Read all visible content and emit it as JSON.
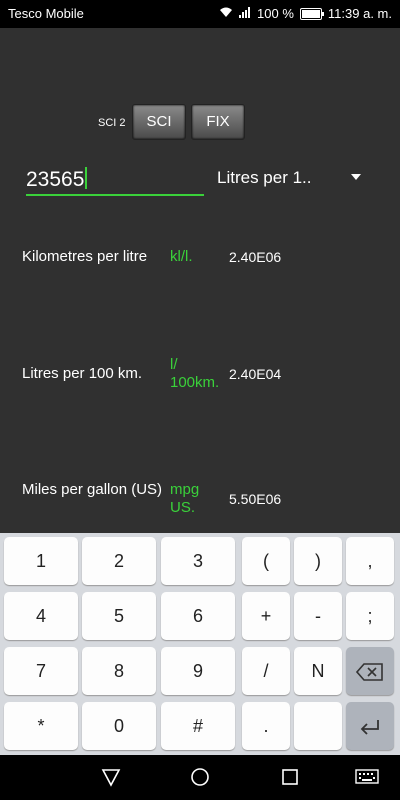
{
  "status": {
    "carrier": "Tesco Mobile",
    "battery": "100 %",
    "battery_level": 1.0,
    "time": "11:39 a. m."
  },
  "mode": {
    "label": "SCI 2",
    "sci": "SCI",
    "fix": "FIX"
  },
  "input": {
    "value": "23565"
  },
  "unit_select": {
    "selected": "Litres per 1.."
  },
  "conversions": [
    {
      "name": "Kilometres per litre",
      "abbr": "kl/l.",
      "value": "2.40E06"
    },
    {
      "name": "Litres per 100 km.",
      "abbr": "l/ 100km.",
      "value": "2.40E04"
    },
    {
      "name": "Miles per gallon (US)",
      "abbr": "mpg US.",
      "value": "5.50E06"
    }
  ],
  "keyboard": {
    "rows": [
      [
        "1",
        "2",
        "3",
        "(",
        ")",
        ","
      ],
      [
        "4",
        "5",
        "6",
        "+",
        "-",
        ";"
      ],
      [
        "7",
        "8",
        "9",
        "/",
        "N",
        ""
      ],
      [
        "*",
        "0",
        "#",
        ".",
        "",
        ""
      ]
    ]
  },
  "colors": {
    "accent": "#3ad13a",
    "background": "#303030"
  }
}
